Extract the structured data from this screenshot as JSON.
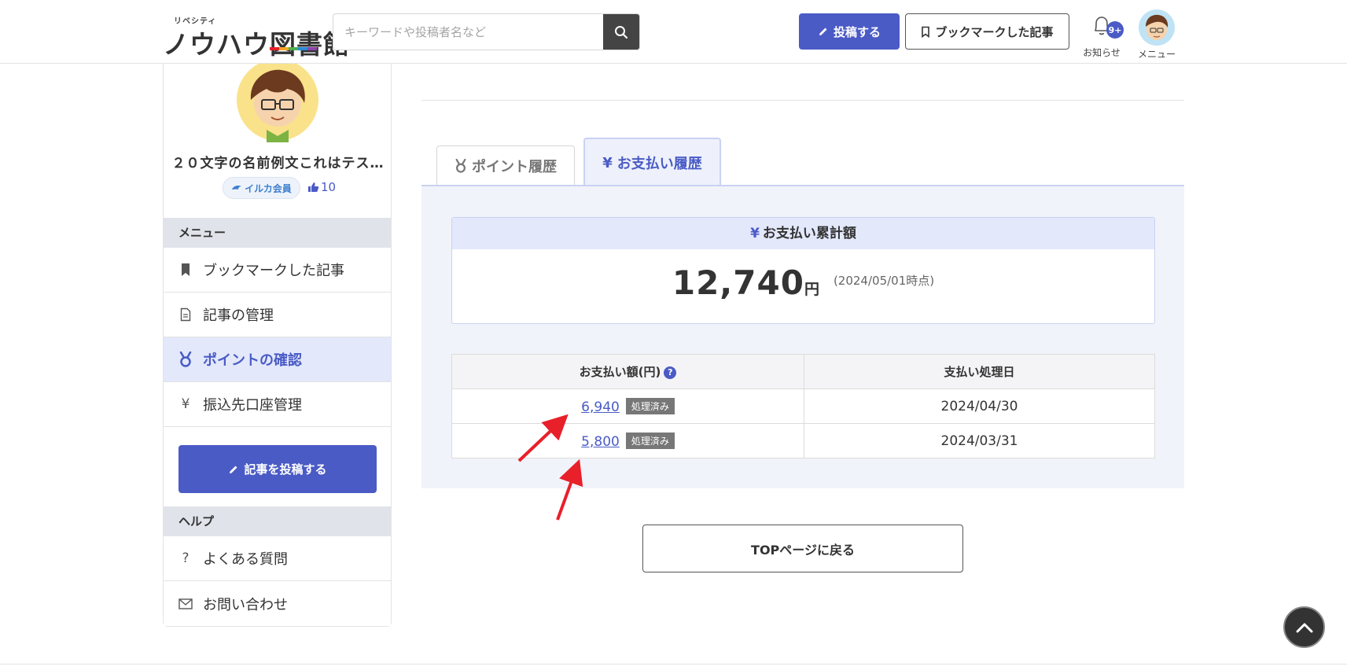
{
  "header": {
    "logo_small": "リベシティ",
    "logo_main": "ノウハウ図書館",
    "search_placeholder": "キーワードや投稿者名など",
    "post_button": "投稿する",
    "bookmark_button": "ブックマークした記事",
    "notify_badge": "9+",
    "notify_label": "お知らせ",
    "menu_label": "メニュー"
  },
  "sidebar": {
    "user_name": "２０文字の名前例文これはテス…",
    "member_badge": "イルカ会員",
    "likes": "10",
    "menu_heading": "メニュー",
    "items": [
      {
        "label": "ブックマークした記事",
        "icon": "bookmark-icon"
      },
      {
        "label": "記事の管理",
        "icon": "document-icon"
      },
      {
        "label": "ポイントの確認",
        "icon": "medal-icon"
      },
      {
        "label": "振込先口座管理",
        "icon": "yen-icon"
      }
    ],
    "post_button": "記事を投稿する",
    "help_heading": "ヘルプ",
    "help_items": [
      {
        "label": "よくある質問",
        "icon": "question-icon"
      },
      {
        "label": "お問い合わせ",
        "icon": "mail-icon"
      }
    ]
  },
  "main": {
    "tabs": [
      {
        "label": "ポイント履歴",
        "active": false
      },
      {
        "label": "お支払い履歴",
        "active": true
      }
    ],
    "total": {
      "heading": "お支払い累計額",
      "amount": "12,740",
      "unit": "円",
      "as_of": "(2024/05/01時点)"
    },
    "table": {
      "headers": [
        "お支払い額(円)",
        "支払い処理日"
      ],
      "help_mark": "?",
      "rows": [
        {
          "amount": "6,940",
          "status": "処理済み",
          "date": "2024/04/30"
        },
        {
          "amount": "5,800",
          "status": "処理済み",
          "date": "2024/03/31"
        }
      ]
    },
    "back_button": "TOPページに戻る"
  },
  "colors": {
    "accent": "#4a5bc6",
    "active_bg": "#e3e8fb",
    "annotation": "#e8202a"
  }
}
